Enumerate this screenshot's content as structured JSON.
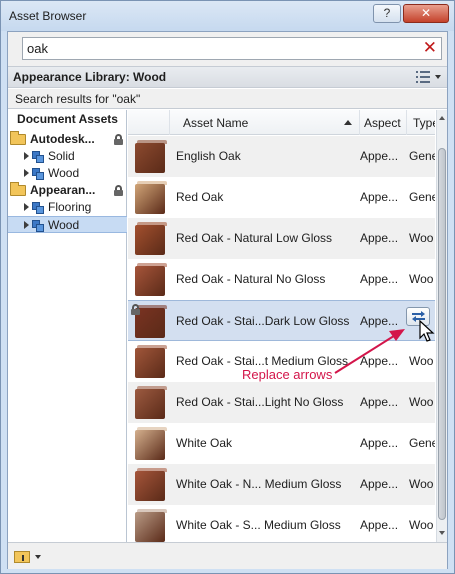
{
  "window": {
    "title": "Asset Browser",
    "help_label": "?",
    "close_label": "✕"
  },
  "search": {
    "value": "oak",
    "clear_icon": "red-x-icon"
  },
  "library": {
    "title": "Appearance Library: Wood",
    "view_icon": "list-view-icon"
  },
  "results_label": "Search results for \"oak\"",
  "tree": {
    "header": "Document Assets",
    "nodes": [
      {
        "label": "Autodesk...",
        "level": 0,
        "icon": "folder-icon",
        "expanded": true,
        "locked": true
      },
      {
        "label": "Solid",
        "level": 1,
        "icon": "category-icon",
        "expanded": false
      },
      {
        "label": "Wood",
        "level": 1,
        "icon": "category-icon",
        "expanded": false
      },
      {
        "label": "Appearan...",
        "level": 0,
        "icon": "folder-icon",
        "expanded": true,
        "locked": true
      },
      {
        "label": "Flooring",
        "level": 1,
        "icon": "category-icon",
        "expanded": false
      },
      {
        "label": "Wood",
        "level": 1,
        "icon": "category-icon",
        "expanded": false,
        "selected": true
      }
    ]
  },
  "grid": {
    "columns": {
      "name": "Asset Name",
      "aspect": "Aspect",
      "type": "Type"
    },
    "rows": [
      {
        "name": "English Oak",
        "aspect": "Appe...",
        "type": "Gene",
        "swatch": "#8c4a2f"
      },
      {
        "name": "Red Oak",
        "aspect": "Appe...",
        "type": "Gene",
        "swatch": "#d1a578"
      },
      {
        "name": "Red Oak - Natural Low Gloss",
        "aspect": "Appe...",
        "type": "Woo",
        "swatch": "#a3502e"
      },
      {
        "name": "Red Oak - Natural No Gloss",
        "aspect": "Appe...",
        "type": "Woo",
        "swatch": "#a6553a"
      },
      {
        "name": "Red Oak - Stai...Dark Low Gloss",
        "aspect": "Appe...",
        "type": "W",
        "swatch": "#7a3322",
        "selected": true,
        "locked": true
      },
      {
        "name": "Red Oak - Stai...t Medium Gloss",
        "aspect": "Appe...",
        "type": "Woo",
        "swatch": "#a0563a"
      },
      {
        "name": "Red Oak - Stai...Light No Gloss",
        "aspect": "Appe...",
        "type": "Woo",
        "swatch": "#9c5a40"
      },
      {
        "name": "White Oak",
        "aspect": "Appe...",
        "type": "Gene",
        "swatch": "#d4b08e"
      },
      {
        "name": "White Oak - N... Medium Gloss",
        "aspect": "Appe...",
        "type": "Woo",
        "swatch": "#a5553a"
      },
      {
        "name": "White Oak - S... Medium Gloss",
        "aspect": "Appe...",
        "type": "Woo",
        "swatch": "#b99b86"
      }
    ]
  },
  "annotation": {
    "text": "Replace arrows",
    "color": "#d3154a"
  },
  "bottom": {
    "icon": "new-library-folder-icon"
  }
}
